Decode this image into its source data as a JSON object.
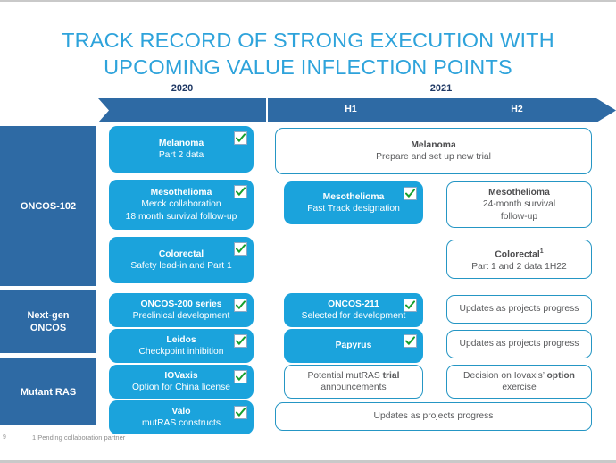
{
  "slide": {
    "title_lines": [
      "TRACK RECORD OF STRONG EXECUTION WITH",
      "UPCOMING VALUE INFLECTION POINTS"
    ],
    "title_color": "#2EA3DB",
    "page_number": "9",
    "footnote": "1 Pending collaboration partner"
  },
  "timeline": {
    "years": [
      {
        "label": "2020"
      },
      {
        "label": "2021"
      }
    ],
    "halves": [
      {
        "label": "H1"
      },
      {
        "label": "H2"
      }
    ],
    "bar_color": "#2E6AA4",
    "year_label_color": "#1F3864"
  },
  "sidebar": {
    "blocks": [
      {
        "label": "ONCOS-102"
      },
      {
        "label": "Next-gen\nONCOS"
      },
      {
        "label": "Mutant RAS"
      }
    ],
    "color": "#2E6AA4"
  },
  "legend": {
    "check_icon": "check-icon",
    "check_color": "#17A02F"
  },
  "colors": {
    "card_blue": "#1BA3DC",
    "card_white_border": "#2596C4",
    "card_white_text": "#58595B"
  },
  "cards": {
    "melanoma_2020": {
      "line1": "Melanoma",
      "line2": "Part 2 data",
      "line3": "",
      "checked": "true"
    },
    "meso_2020": {
      "line1": "Mesothelioma",
      "line2": "Merck collaboration",
      "line3": "18 month survival follow-up",
      "checked": "true"
    },
    "colorectal_2020": {
      "line1": "Colorectal",
      "line2": "Safety lead-in and Part 1",
      "line3": "",
      "checked": "true"
    },
    "oncos200_2020": {
      "line1": "ONCOS-200 series",
      "line2": "Preclinical development",
      "line3": "",
      "checked": "true"
    },
    "leidos_2020": {
      "line1": "Leidos",
      "line2": "Checkpoint inhibition",
      "line3": "",
      "checked": "true"
    },
    "iovaxis_2020": {
      "line1": "IOVaxis",
      "line2": "Option for China license",
      "line3": "",
      "checked": "true"
    },
    "valo_2020": {
      "line1": "Valo",
      "line2": "mutRAS constructs",
      "line3": "",
      "checked": "true"
    },
    "melanoma_2021": {
      "line1": "Melanoma",
      "line2": "Prepare and set up new trial",
      "line3": "",
      "checked": "false"
    },
    "meso_h1": {
      "line1": "Mesothelioma",
      "line2": "Fast Track designation",
      "line3": "",
      "checked": "true"
    },
    "meso_h2": {
      "line1": "Mesothelioma",
      "line2": "24-month survival",
      "line3": "follow-up",
      "checked": "false"
    },
    "colorectal_h2": {
      "line1": "Colorectal",
      "line1_sup": "1",
      "line2": "Part 1 and 2 data 1H22",
      "line3": "",
      "checked": "false"
    },
    "oncos211_h1": {
      "line1": "ONCOS-211",
      "line2": "Selected for development",
      "line3": "",
      "checked": "true"
    },
    "updates_h2_a": {
      "line1": "",
      "line2": "Updates as projects progress",
      "line3": "",
      "checked": "false"
    },
    "papyrus_h1": {
      "line1": "Papyrus",
      "line2": "",
      "line3": "",
      "checked": "true"
    },
    "updates_h2_b": {
      "line1": "",
      "line2": "Updates as projects progress",
      "line3": "",
      "checked": "false"
    },
    "mutras_h1": {
      "pre": "Potential mutRAS ",
      "bold": "trial",
      "post": "",
      "line2": "announcements",
      "checked": "false"
    },
    "iovaxis_h2": {
      "pre": "Decision on Iovaxis’ ",
      "bold": "option",
      "post": "",
      "line2": "exercise",
      "checked": "false"
    },
    "updates_span": {
      "line1": "",
      "line2": "Updates as projects progress",
      "line3": "",
      "checked": "false"
    }
  }
}
